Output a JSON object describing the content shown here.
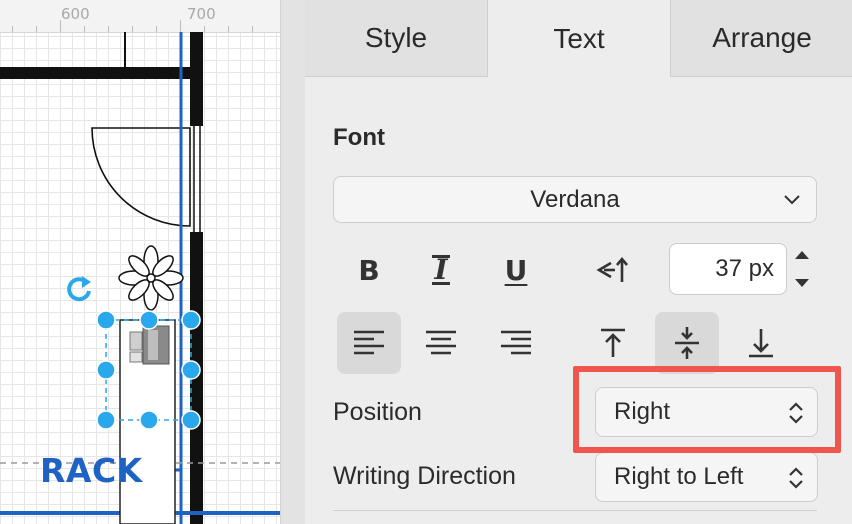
{
  "canvas": {
    "ruler_labels": [
      "600",
      "700"
    ],
    "shape_label": "RACK"
  },
  "panel": {
    "tabs": [
      {
        "label": "Style",
        "active": false
      },
      {
        "label": "Text",
        "active": true
      },
      {
        "label": "Arrange",
        "active": false
      }
    ],
    "font": {
      "heading": "Font",
      "family": "Verdana",
      "size": "37 px",
      "bold_glyph": "B",
      "italic_glyph": "I",
      "underline_glyph": "U"
    },
    "alignment": {
      "horizontal_selected": "left",
      "vertical_selected": "middle"
    },
    "position": {
      "label": "Position",
      "value": "Right"
    },
    "writing_direction": {
      "label": "Writing Direction",
      "value": "Right to Left"
    }
  },
  "colors": {
    "selection": "#29a8ec",
    "guide": "#1e63c4",
    "highlight": "#f0564e",
    "active_button": "#d9d9d9"
  },
  "icons": [
    "rotate-icon",
    "chevron-down-icon",
    "text-direction-icon",
    "align-left-icon",
    "align-center-icon",
    "align-right-icon",
    "align-top-icon",
    "align-middle-icon",
    "align-bottom-icon",
    "stepper-icon"
  ]
}
